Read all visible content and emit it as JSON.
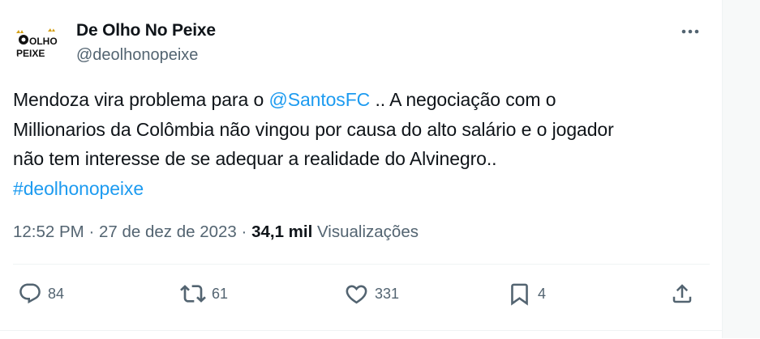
{
  "author": {
    "display_name": "De Olho No Peixe",
    "handle": "@deolhonopeixe",
    "avatar_text_top": "OLHO",
    "avatar_text_bottom": "PEIXE"
  },
  "tweet": {
    "line1_before": "Mendoza vira problema para o ",
    "mention": "@SantosFC",
    "line1_after": " .. A negociação com o",
    "line2": "Millionarios da Colômbia não vingou por causa do alto salário e o jogador",
    "line3": "não tem interesse de se adequar a realidade do Alvinegro..",
    "hashtag": "#deolhonopeixe"
  },
  "meta": {
    "time": "12:52 PM",
    "separator": "·",
    "date": "27 de dez de 2023",
    "views_count": "34,1 mil",
    "views_label": "Visualizações"
  },
  "actions": {
    "replies": "84",
    "reposts": "61",
    "likes": "331",
    "bookmarks": "4"
  },
  "colors": {
    "text": "#0f1419",
    "secondary": "#536471",
    "link": "#1d9bf0"
  }
}
